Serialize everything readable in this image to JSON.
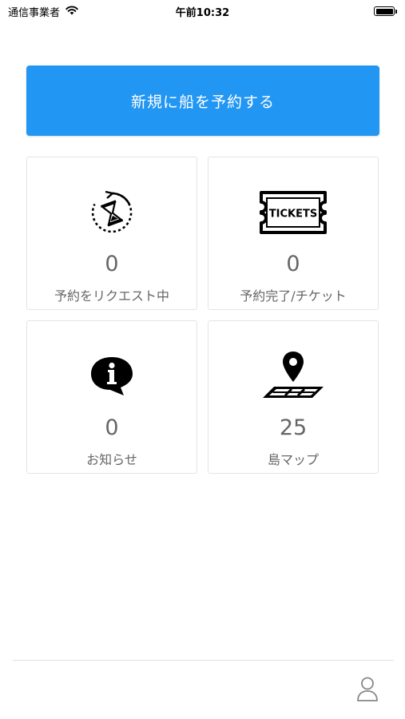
{
  "status_bar": {
    "carrier": "通信事業者",
    "time": "午前10:32",
    "icons": {
      "wifi": "wifi-icon",
      "battery": "battery-icon"
    }
  },
  "reserve_button": {
    "label": "新規に船を予約する",
    "color": "#2196f3"
  },
  "cards": {
    "request": {
      "count": "0",
      "label": "予約をリクエスト中",
      "icon": "hourglass-icon"
    },
    "tickets": {
      "count": "0",
      "label": "予約完了/チケット",
      "icon": "tickets-icon",
      "icon_text": "TICKETS"
    },
    "notices": {
      "count": "0",
      "label": "お知らせ",
      "icon": "info-bubble-icon"
    },
    "map": {
      "count": "25",
      "label": "島マップ",
      "icon": "map-pin-icon"
    }
  },
  "tab_bar": {
    "profile_icon": "person-icon"
  }
}
